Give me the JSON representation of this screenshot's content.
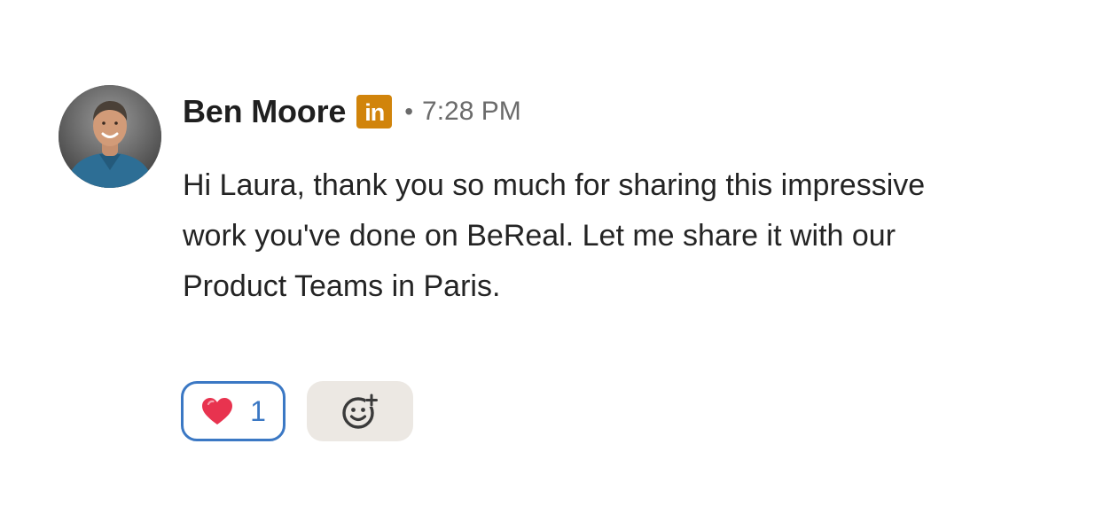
{
  "message": {
    "sender": {
      "name": "Ben Moore",
      "badge_text": "in",
      "badge_icon": "linkedin-icon",
      "badge_color": "#d1840b",
      "avatar_icon": "avatar-photo"
    },
    "separator": "•",
    "timestamp": "7:28 PM",
    "body_lines": [
      "Hi Laura, thank you so much for sharing this impressive",
      "work you've done on BeReal. Let me share it with our",
      "Product Teams in Paris."
    ]
  },
  "reactions": [
    {
      "icon": "heart-icon",
      "count": "1",
      "selected": true,
      "accent_color": "#3b78c4",
      "heart_color": "#e8334f"
    }
  ],
  "add_reaction": {
    "icon": "smiley-add-icon",
    "background": "#ece8e3"
  }
}
